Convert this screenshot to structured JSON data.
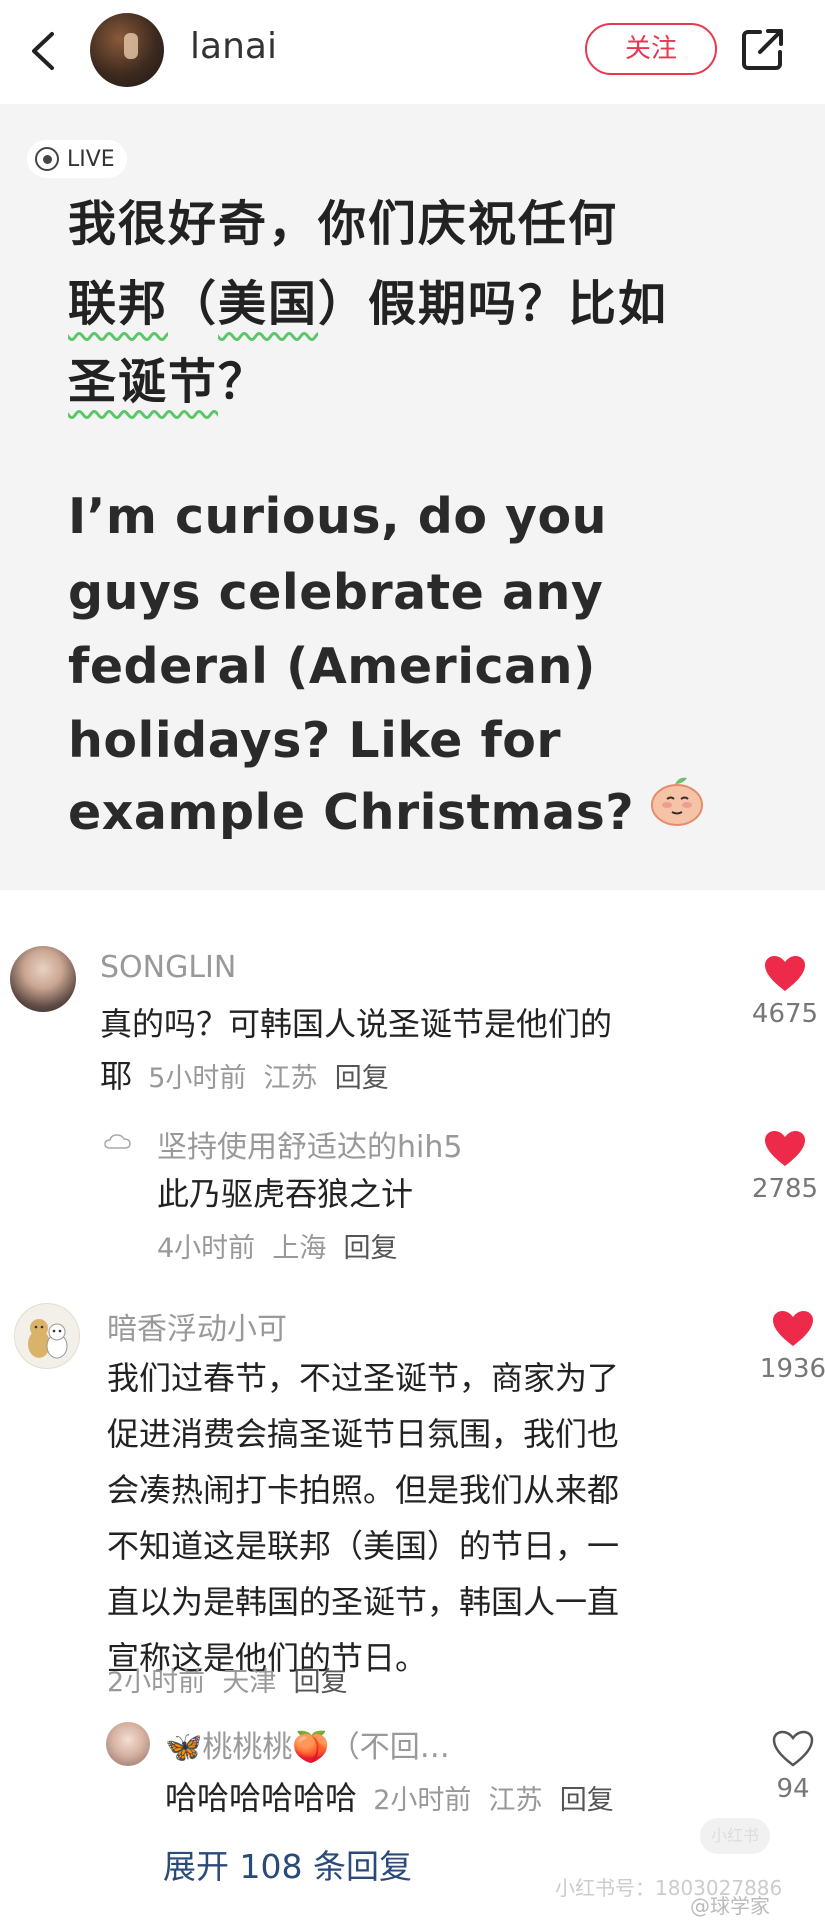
{
  "header": {
    "author": "lanai",
    "follow_label": "关注"
  },
  "post": {
    "live_label": "LIVE",
    "cn_line1": "我很好奇，你们庆祝任何",
    "cn_line2_hl1": "联邦",
    "cn_line2_mid": "（",
    "cn_line2_hl2": "美国",
    "cn_line2_rest": "）假期吗？比如",
    "cn_line3_hl": "圣诞节",
    "cn_line3_rest": "？",
    "en_lines": [
      " I’m curious, do you",
      "guys celebrate any",
      "federal (American)",
      "holidays? Like for",
      "example Christmas?"
    ]
  },
  "comments": [
    {
      "user": "SONGLIN",
      "text": "真的吗？可韩国人说圣诞节是他们的",
      "text2": "耶",
      "time": "5小时前",
      "location": "江苏",
      "reply": "回复",
      "likes": "4675"
    },
    {
      "user": "坚持使用舒适达的hih5",
      "text": "此乃驱虎吞狼之计",
      "time": "4小时前",
      "location": "上海",
      "reply": "回复",
      "likes": "2785"
    },
    {
      "user": "暗香浮动小可",
      "lines": [
        "我们过春节，不过圣诞节，商家为了",
        "促进消费会搞圣诞节日氛围，我们也",
        "会凑热闹打卡拍照。但是我们从来都",
        "不知道这是联邦（美国）的节日，一",
        "直以为是韩国的圣诞节，韩国人一直",
        "宣称这是他们的节日。"
      ],
      "time": "2小时前",
      "location": "天津",
      "reply": "回复",
      "likes": "1936"
    },
    {
      "user": "🦋桃桃桃🍑（不回…",
      "text": "哈哈哈哈哈哈",
      "time": "2小时前",
      "location": "江苏",
      "reply": "回复",
      "likes": "94"
    }
  ],
  "expand_label": "展开 108 条回复",
  "watermark": "小红书号：1803027886",
  "watermark2": "@球学家",
  "faint_badge": "小红书",
  "colors": {
    "accent": "#e8384f",
    "heart": "#ee2a4a",
    "underline": "#5bc76a",
    "card_bg": "#f4f4f5"
  }
}
